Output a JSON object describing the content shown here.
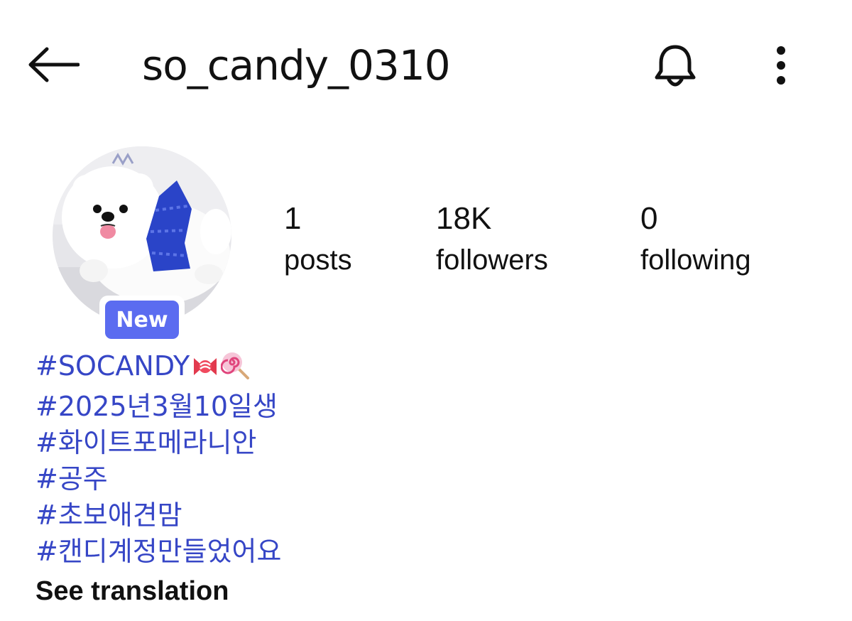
{
  "header": {
    "username": "so_candy_0310",
    "back_icon": "arrow-left-icon",
    "notification_icon": "bell-icon",
    "more_icon": "more-vertical-icon"
  },
  "profile": {
    "avatar_description_icon": "white-pomeranian-avatar",
    "badge_label": "New",
    "badge_color": "#5b6cf0"
  },
  "stats": [
    {
      "value": "1",
      "label": "posts"
    },
    {
      "value": "18K",
      "label": "followers"
    },
    {
      "value": "0",
      "label": "following"
    }
  ],
  "bio": {
    "hashtags": [
      "#SOCANDY",
      "#2025년3월10일생",
      "#화이트포메라니안",
      "#공주",
      "#초보애견맘",
      "#캔디계정만들었어요"
    ],
    "first_hashtag_emojis": [
      "candy-icon",
      "lollipop-icon"
    ],
    "hashtag_color": "#3646c6",
    "see_translation": "See translation"
  }
}
